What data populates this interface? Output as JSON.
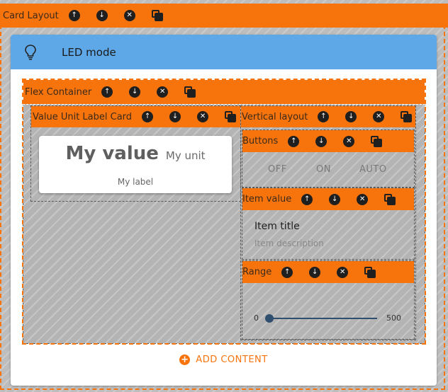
{
  "card_layout": {
    "label": "Card Layout"
  },
  "card": {
    "title": "LED mode",
    "icon": "lightbulb-icon"
  },
  "flex_container": {
    "label": "Flex Container"
  },
  "value_unit_card": {
    "bar_label": "Value Unit Label Card",
    "value": "My value",
    "unit": "My unit",
    "label": "My label"
  },
  "vertical_layout": {
    "label": "Vertical layout"
  },
  "buttons": {
    "bar_label": "Buttons",
    "items": [
      "OFF",
      "ON",
      "AUTO"
    ]
  },
  "item_value": {
    "bar_label": "Item value",
    "title": "Item title",
    "description": "Item description"
  },
  "range": {
    "bar_label": "Range",
    "min": "0",
    "max": "500",
    "value": 0
  },
  "add_content": {
    "label": "ADD CONTENT"
  },
  "colors": {
    "accent": "#f7740d",
    "header": "#5ea8e8",
    "icon": "#1f1f1f",
    "slider": "#2f4f6f"
  }
}
